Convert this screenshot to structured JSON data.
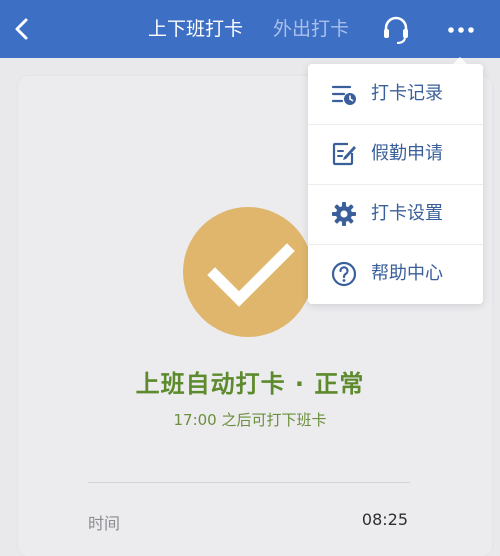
{
  "header": {
    "tabs": [
      {
        "label": "上下班打卡",
        "active": true
      },
      {
        "label": "外出打卡",
        "active": false
      }
    ],
    "icons": [
      "back-icon",
      "headset-icon",
      "more-icon"
    ]
  },
  "menu": {
    "items": [
      {
        "label": "打卡记录",
        "icon": "record-icon"
      },
      {
        "label": "假勤申请",
        "icon": "edit-icon"
      },
      {
        "label": "打卡设置",
        "icon": "gear-icon"
      },
      {
        "label": "帮助中心",
        "icon": "help-icon"
      }
    ]
  },
  "status": {
    "title": "上班自动打卡 · 正常",
    "subtitle": "17:00 之后可打下班卡",
    "icon": "check-icon"
  },
  "record": {
    "time_label": "时间",
    "time_value": "08:25"
  },
  "colors": {
    "header": "#3d6fc4",
    "accent_blue": "#3a5f9a",
    "status_circle": "#dfb66c",
    "status_green": "#5c8a2c"
  }
}
